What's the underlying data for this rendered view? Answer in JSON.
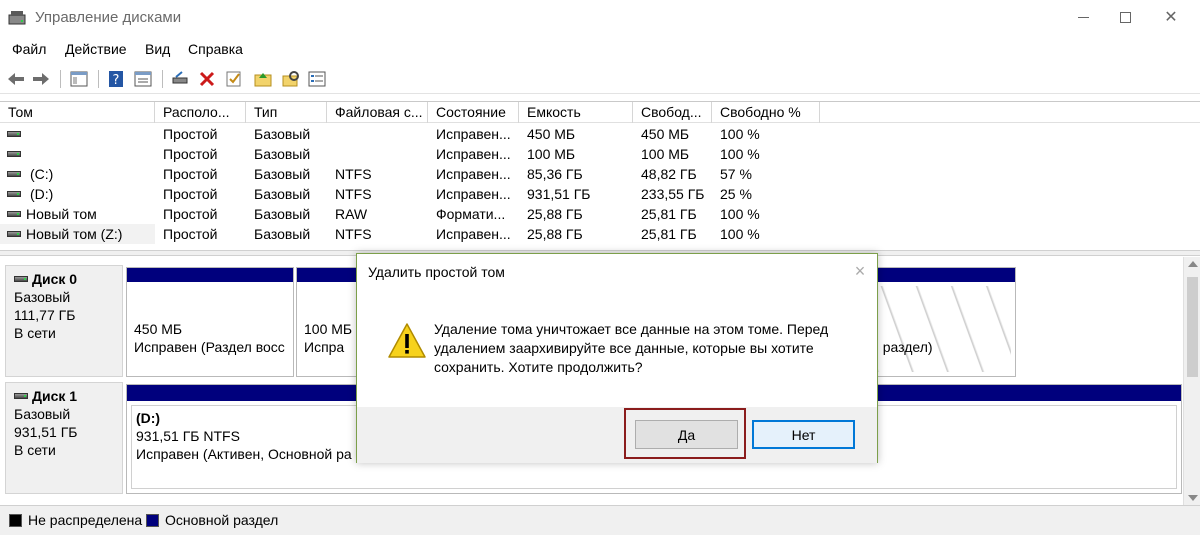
{
  "window": {
    "title": "Управление дисками"
  },
  "menu": [
    "Файл",
    "Действие",
    "Вид",
    "Справка"
  ],
  "toolbar_icons": [
    "back-arrow-icon",
    "forward-arrow-icon",
    "console-tree-icon",
    "help-icon",
    "properties-icon",
    "connect-icon",
    "delete-icon",
    "check-icon",
    "folder-up-icon",
    "search-folder-icon",
    "list-icon"
  ],
  "volumes": {
    "columns": [
      "Том",
      "Располо...",
      "Тип",
      "Файловая с...",
      "Состояние",
      "Емкость",
      "Свобод...",
      "Свободно %"
    ],
    "rows": [
      [
        "",
        "Простой",
        "Базовый",
        "",
        "Исправен...",
        "450 МБ",
        "450 МБ",
        "100 %"
      ],
      [
        "",
        "Простой",
        "Базовый",
        "",
        "Исправен...",
        "100 МБ",
        "100 МБ",
        "100 %"
      ],
      [
        "(C:)",
        "Простой",
        "Базовый",
        "NTFS",
        "Исправен...",
        "85,36 ГБ",
        "48,82 ГБ",
        "57 %"
      ],
      [
        "(D:)",
        "Простой",
        "Базовый",
        "NTFS",
        "Исправен...",
        "931,51 ГБ",
        "233,55 ГБ",
        "25 %"
      ],
      [
        "Новый том",
        "Простой",
        "Базовый",
        "RAW",
        "Формати...",
        "25,88 ГБ",
        "25,81 ГБ",
        "100 %"
      ],
      [
        "Новый том (Z:)",
        "Простой",
        "Базовый",
        "NTFS",
        "Исправен...",
        "25,88 ГБ",
        "25,81 ГБ",
        "100 %"
      ]
    ]
  },
  "disks": [
    {
      "name": "Диск 0",
      "type": "Базовый",
      "size": "111,77 ГБ",
      "status": "В сети",
      "partitions": [
        {
          "line1": "450 МБ",
          "line2": "Исправен (Раздел восс"
        },
        {
          "line1": "100 МБ",
          "line2": "Испра"
        },
        {
          "line1": "",
          "line2": "й раздел)"
        }
      ]
    },
    {
      "name": "Диск 1",
      "type": "Базовый",
      "size": "931,51 ГБ",
      "status": "В сети",
      "partitions": [
        {
          "line1": "(D:)",
          "line2": "931,51 ГБ NTFS",
          "line3": "Исправен (Активен, Основной ра"
        }
      ]
    }
  ],
  "legend": [
    {
      "label": "Не распределена",
      "color": "#000000"
    },
    {
      "label": "Основной раздел",
      "color": "#00007d"
    }
  ],
  "dialog": {
    "title": "Удалить простой том",
    "message_lines": [
      "Удаление тома уничтожает все данные на этом томе. Перед",
      "удалением заархивируйте все данные, которые вы хотите",
      "сохранить. Хотите продолжить?"
    ],
    "yes_label": "Да",
    "no_label": "Нет"
  }
}
